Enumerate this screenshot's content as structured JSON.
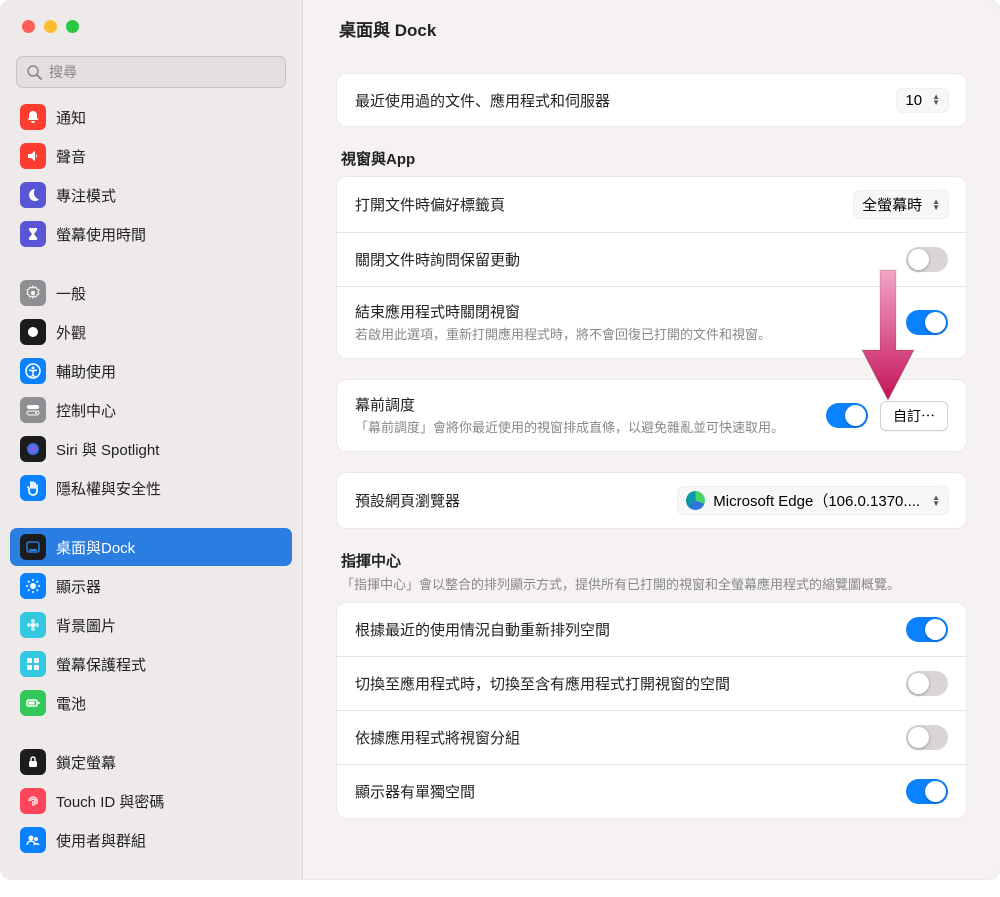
{
  "search": {
    "placeholder": "搜尋"
  },
  "sidebar": {
    "items": [
      {
        "id": "notifications",
        "label": "通知",
        "color": "#ff3c30",
        "glyph": "bell"
      },
      {
        "id": "sound",
        "label": "聲音",
        "color": "#ff3c30",
        "glyph": "speaker"
      },
      {
        "id": "focus",
        "label": "專注模式",
        "color": "#5856d6",
        "glyph": "moon"
      },
      {
        "id": "screen-time",
        "label": "螢幕使用時間",
        "color": "#5856d6",
        "glyph": "hourglass"
      },
      {
        "gap": true
      },
      {
        "id": "general",
        "label": "一般",
        "color": "#8e8e93",
        "glyph": "gear"
      },
      {
        "id": "appearance",
        "label": "外觀",
        "color": "#1c1c1e",
        "glyph": "appearance"
      },
      {
        "id": "accessibility",
        "label": "輔助使用",
        "color": "#0a82ff",
        "glyph": "accessibility"
      },
      {
        "id": "control-center",
        "label": "控制中心",
        "color": "#8e8e93",
        "glyph": "switches"
      },
      {
        "id": "siri",
        "label": "Siri 與 Spotlight",
        "color": "#1c1c1e",
        "glyph": "siri"
      },
      {
        "id": "privacy",
        "label": "隱私權與安全性",
        "color": "#0a82ff",
        "glyph": "hand"
      },
      {
        "gap": true
      },
      {
        "id": "desktop-dock",
        "label": "桌面與Dock",
        "color": "#1c1c1e",
        "glyph": "dock"
      },
      {
        "id": "displays",
        "label": "顯示器",
        "color": "#0a82ff",
        "glyph": "brightness"
      },
      {
        "id": "wallpaper",
        "label": "背景圖片",
        "color": "#34c8e0",
        "glyph": "flower"
      },
      {
        "id": "screensaver",
        "label": "螢幕保護程式",
        "color": "#34c8e0",
        "glyph": "tiles"
      },
      {
        "id": "battery",
        "label": "電池",
        "color": "#34c759",
        "glyph": "battery"
      },
      {
        "gap": true
      },
      {
        "id": "lock-screen",
        "label": "鎖定螢幕",
        "color": "#1c1c1e",
        "glyph": "lock"
      },
      {
        "id": "touch-id",
        "label": "Touch ID 與密碼",
        "color": "#ff465b",
        "glyph": "fingerprint"
      },
      {
        "id": "users",
        "label": "使用者與群組",
        "color": "#0a82ff",
        "glyph": "users"
      }
    ],
    "selected": "desktop-dock"
  },
  "header": {
    "title": "桌面與 Dock"
  },
  "recent": {
    "label": "最近使用過的文件、應用程式和伺服器",
    "value": "10"
  },
  "windows_section": {
    "title": "視窗與App"
  },
  "prefer_tabs": {
    "label": "打開文件時偏好標籤頁",
    "value": "全螢幕時"
  },
  "ask_keep_changes": {
    "label": "關閉文件時詢問保留更動",
    "on": false
  },
  "close_windows_quit": {
    "label": "結束應用程式時關閉視窗",
    "desc": "若啟用此選項，重新打開應用程式時，將不會回復已打開的文件和視窗。",
    "on": true
  },
  "stage_manager": {
    "label": "幕前調度",
    "desc": "「幕前調度」會將你最近使用的視窗排成直條，以避免雜亂並可快速取用。",
    "on": true,
    "button": "自訂⋯"
  },
  "default_browser": {
    "label": "預設網頁瀏覽器",
    "value": "Microsoft Edge（106.0.1370....",
    "icon": "edge"
  },
  "mission_control": {
    "title": "指揮中心",
    "desc": "「指揮中心」會以整合的排列顯示方式，提供所有已打開的視窗和全螢幕應用程式的縮覽圖概覽。"
  },
  "mc_auto_rearrange": {
    "label": "根據最近的使用情況自動重新排列空間",
    "on": true
  },
  "mc_switch_space": {
    "label": "切換至應用程式時，切換至含有應用程式打開視窗的空間",
    "on": false
  },
  "mc_group_by_app": {
    "label": "依據應用程式將視窗分組",
    "on": false
  },
  "mc_displays_spaces": {
    "label": "顯示器有單獨空間",
    "on": true
  }
}
